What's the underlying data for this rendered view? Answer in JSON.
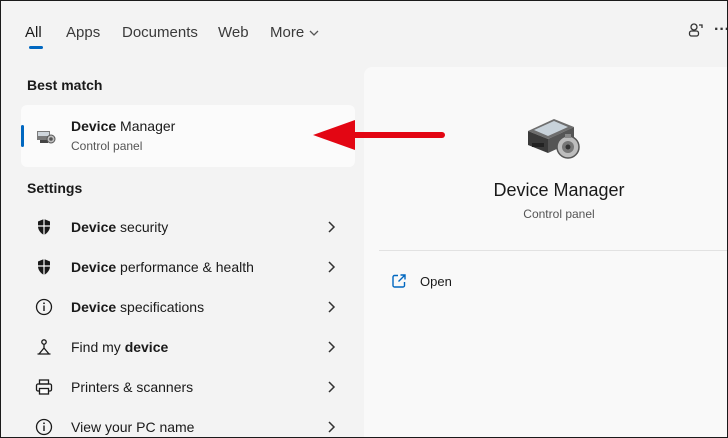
{
  "tabs": {
    "all": "All",
    "apps": "Apps",
    "documents": "Documents",
    "web": "Web",
    "more": "More"
  },
  "top_icons": {
    "share": "share-people-icon",
    "menu": "more-options-icon",
    "menu_glyph": "···"
  },
  "best_match": {
    "section_title": "Best match",
    "title_bold": "Device",
    "title_rest": " Manager",
    "subtitle": "Control panel",
    "icon": "device-manager-icon"
  },
  "settings": {
    "section_title": "Settings",
    "items": [
      {
        "bold": "Device",
        "rest": " security",
        "icon": "shield-icon"
      },
      {
        "bold": "Device",
        "rest": " performance & health",
        "icon": "shield-icon"
      },
      {
        "pre": "",
        "bold": "Device",
        "rest": " specifications",
        "icon": "info-icon"
      },
      {
        "pre": "Find my ",
        "bold": "device",
        "rest": "",
        "icon": "find-device-icon"
      },
      {
        "pre": "Printers & scanners",
        "bold": "",
        "rest": "",
        "icon": "printer-icon"
      },
      {
        "pre": "View your PC name",
        "bold": "",
        "rest": "",
        "icon": "info-icon"
      }
    ]
  },
  "detail": {
    "title": "Device Manager",
    "subtitle": "Control panel",
    "open_label": "Open"
  },
  "colors": {
    "accent": "#0067c0",
    "arrow": "#e30613"
  }
}
